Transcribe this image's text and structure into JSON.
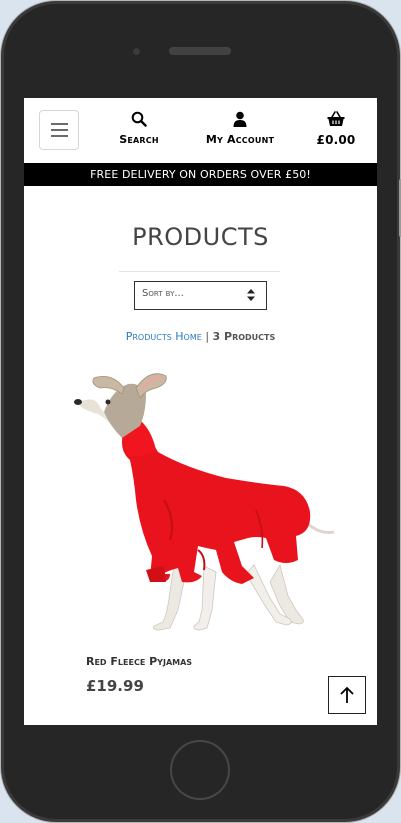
{
  "header": {
    "search_label": "Search",
    "account_label": "My Account",
    "basket_total": "£0.00"
  },
  "banner": {
    "text": "FREE DELIVERY ON ORDERS OVER £50!"
  },
  "main": {
    "title": "PRODUCTS",
    "sort": {
      "selected": "Sort by..."
    },
    "breadcrumb": {
      "home_link": "Products Home",
      "separator": "|",
      "count": "3 Products"
    },
    "products": [
      {
        "name": "Red Fleece Pyjamas",
        "price": "£19.99",
        "image_alt": "greyhound-in-red-fleece-pyjamas"
      }
    ]
  },
  "icons": {
    "menu": "hamburger-icon",
    "search": "search-icon",
    "account": "user-icon",
    "basket": "basket-icon",
    "sort": "sort-arrows-icon",
    "back_to_top": "arrow-up-icon"
  },
  "colors": {
    "banner_bg": "#000000",
    "link": "#2a7bc0",
    "text": "#444444"
  }
}
